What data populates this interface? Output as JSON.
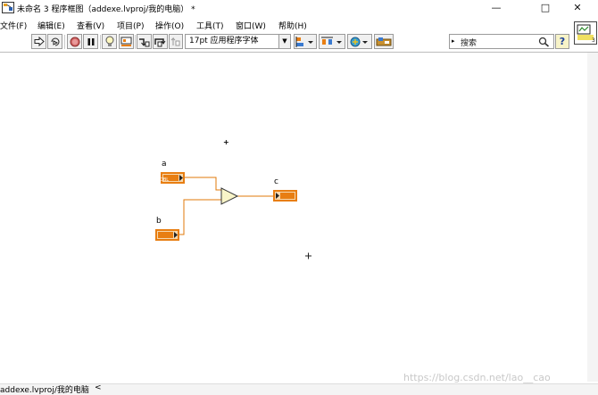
{
  "window": {
    "title": "未命名 3 程序框图（addexe.lvproj/我的电脑） *",
    "minimize": "—",
    "maximize": "□",
    "close": "✕"
  },
  "menu": [
    {
      "label": "文件(F)"
    },
    {
      "label": "编辑(E)"
    },
    {
      "label": "查看(V)"
    },
    {
      "label": "项目(P)"
    },
    {
      "label": "操作(O)"
    },
    {
      "label": "工具(T)"
    },
    {
      "label": "窗口(W)"
    },
    {
      "label": "帮助(H)"
    }
  ],
  "toolbar": {
    "font_setting": "17pt 应用程序字体",
    "search_placeholder": "搜索",
    "help": "?"
  },
  "diagram": {
    "control_a": {
      "label": "a",
      "type": "DBL"
    },
    "control_b": {
      "label": "b",
      "type": "DBL"
    },
    "indicator_c": {
      "label": "c",
      "type": "DBL"
    },
    "add_node": "+",
    "colors": {
      "wire": "#e0780a",
      "terminal": "#e87e12",
      "terminal_fill": "#f6d8ae"
    }
  },
  "status": {
    "context": "addexe.lvproj/我的电脑"
  },
  "watermark": "https://blog.csdn.net/lao__cao"
}
